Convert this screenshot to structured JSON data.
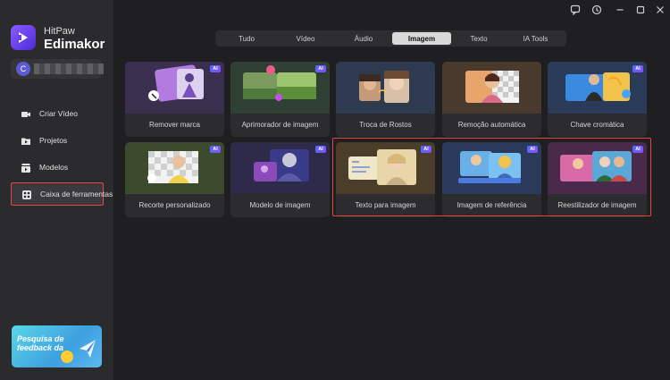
{
  "brand": {
    "top": "HitPaw",
    "main": "Edimakor"
  },
  "user": {
    "avatar": "C"
  },
  "nav": [
    {
      "label": "Criar Vídeo",
      "icon": "video-camera-icon"
    },
    {
      "label": "Projetos",
      "icon": "folder-icon"
    },
    {
      "label": "Modelos",
      "icon": "template-icon"
    },
    {
      "label": "Caixa de ferramentas",
      "icon": "toolbox-icon",
      "active": true
    }
  ],
  "feedback": {
    "text": "Pesquisa de feedback da"
  },
  "tabs": [
    {
      "label": "Tudo"
    },
    {
      "label": "Vídeo"
    },
    {
      "label": "Áudio"
    },
    {
      "label": "Imagem",
      "active": true
    },
    {
      "label": "Texto"
    },
    {
      "label": "IA Tools"
    }
  ],
  "badge": "AI",
  "cards": [
    {
      "label": "Remover marca"
    },
    {
      "label": "Aprimorador de imagem"
    },
    {
      "label": "Troca de Rostos"
    },
    {
      "label": "Remoção automática"
    },
    {
      "label": "Chave cromática"
    },
    {
      "label": "Recorte personalizado"
    },
    {
      "label": "Modelo de imagem"
    },
    {
      "label": "Texto para imagem"
    },
    {
      "label": "Imagem de referência"
    },
    {
      "label": "Reestilizador de imagem"
    }
  ]
}
